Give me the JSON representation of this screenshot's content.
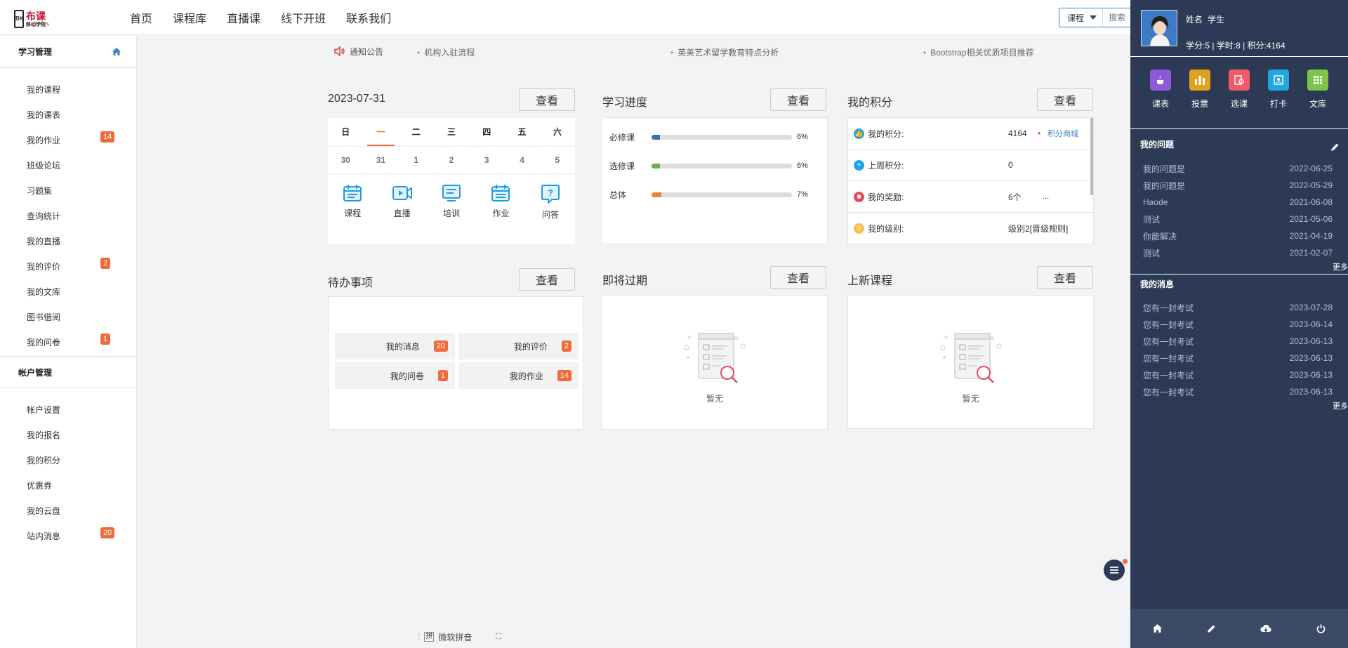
{
  "header": {
    "logo_text": "布课",
    "logo_sub": "移动学院",
    "nav": [
      "首页",
      "课程库",
      "直播课",
      "线下开班",
      "联系我们"
    ],
    "search_select": "课程",
    "search_placeholder": "搜索"
  },
  "sidebar": {
    "section1_title": "学习管理",
    "section1_items": [
      {
        "label": "我的课程",
        "badge": ""
      },
      {
        "label": "我的课表",
        "badge": ""
      },
      {
        "label": "我的作业",
        "badge": "14"
      },
      {
        "label": "班级论坛",
        "badge": ""
      },
      {
        "label": "习题集",
        "badge": ""
      },
      {
        "label": "查询统计",
        "badge": ""
      },
      {
        "label": "我的直播",
        "badge": ""
      },
      {
        "label": "我的评价",
        "badge": "2"
      },
      {
        "label": "我的文库",
        "badge": ""
      },
      {
        "label": "图书借阅",
        "badge": ""
      },
      {
        "label": "我的问卷",
        "badge": "1"
      }
    ],
    "section2_title": "帐户管理",
    "section2_items": [
      {
        "label": "帐户设置",
        "badge": ""
      },
      {
        "label": "我的报名",
        "badge": ""
      },
      {
        "label": "我的积分",
        "badge": ""
      },
      {
        "label": "优惠券",
        "badge": ""
      },
      {
        "label": "我的云盘",
        "badge": ""
      },
      {
        "label": "站内消息",
        "badge": "20"
      }
    ]
  },
  "notice": {
    "label": "通知公告",
    "items": [
      "机构入驻流程",
      "英美艺术留学教育特点分析",
      "Bootstrap相关优质项目推荐"
    ]
  },
  "view_label": "查看",
  "calendar": {
    "date": "2023-07-31",
    "weekdays": [
      "日",
      "一",
      "二",
      "三",
      "四",
      "五",
      "六"
    ],
    "dates": [
      "30",
      "31",
      "1",
      "2",
      "3",
      "4",
      "5"
    ],
    "active_index": 1,
    "icons": [
      {
        "name": "course-icon",
        "label": "课程"
      },
      {
        "name": "live-icon",
        "label": "直播"
      },
      {
        "name": "training-icon",
        "label": "培训"
      },
      {
        "name": "homework-icon",
        "label": "作业"
      },
      {
        "name": "qa-icon",
        "label": "问答"
      }
    ]
  },
  "progress": {
    "title": "学习进度",
    "rows": [
      {
        "label": "必修课",
        "percent": 6,
        "pct_text": "6%",
        "color": "#3b6cb7"
      },
      {
        "label": "选修课",
        "percent": 6,
        "pct_text": "6%",
        "color": "#6ab04c"
      },
      {
        "label": "总体",
        "percent": 7,
        "pct_text": "7%",
        "color": "#e8843a"
      }
    ]
  },
  "points": {
    "title": "我的积分",
    "rows": [
      {
        "icon": "thumbs-up-icon",
        "label": "我的积分:",
        "value": "4164",
        "link": "积分商城"
      },
      {
        "icon": "plus-circle-icon",
        "label": "上周积分:",
        "value": "0",
        "link": ""
      },
      {
        "icon": "gift-icon",
        "label": "我的奖励:",
        "value": "6个",
        "link": "..."
      },
      {
        "icon": "smile-icon",
        "label": "我的级别:",
        "value": "级别2[晋级规则]",
        "link": ""
      }
    ]
  },
  "todo": {
    "title": "待办事项",
    "items": [
      {
        "label": "我的消息",
        "badge": "20"
      },
      {
        "label": "我的评价",
        "badge": "2"
      },
      {
        "label": "我的问卷",
        "badge": "1"
      },
      {
        "label": "我的作业",
        "badge": "14"
      }
    ]
  },
  "expiring": {
    "title": "即将过期",
    "empty_text": "暂无"
  },
  "new_courses": {
    "title": "上新课程",
    "empty_text": "暂无"
  },
  "user": {
    "name": "姓名",
    "role": "学生",
    "stats": "学分:5 | 学时:8 | 积分:4164"
  },
  "quick": [
    {
      "label": "课表",
      "color": "#8c5ad8",
      "icon": "coffee-icon"
    },
    {
      "label": "投票",
      "color": "#e0a020",
      "icon": "bar-chart-icon"
    },
    {
      "label": "选课",
      "color": "#f05a6a",
      "icon": "select-course-icon"
    },
    {
      "label": "打卡",
      "color": "#22a8e0",
      "icon": "checkin-icon"
    },
    {
      "label": "文库",
      "color": "#7ec34a",
      "icon": "grid-icon"
    }
  ],
  "questions": {
    "title": "我的问题",
    "more": "更多",
    "rows": [
      {
        "text": "我的问题是",
        "date": "2022-06-25"
      },
      {
        "text": "我的问题是",
        "date": "2022-05-29"
      },
      {
        "text": "Haode",
        "date": "2021-06-08"
      },
      {
        "text": "测试",
        "date": "2021-05-06"
      },
      {
        "text": "你能解决",
        "date": "2021-04-19"
      },
      {
        "text": "测试",
        "date": "2021-02-07"
      }
    ]
  },
  "messages": {
    "title": "我的消息",
    "more": "更多",
    "rows": [
      {
        "text": "您有一封考试",
        "date": "2023-07-28"
      },
      {
        "text": "您有一封考试",
        "date": "2023-06-14"
      },
      {
        "text": "您有一封考试",
        "date": "2023-06-13"
      },
      {
        "text": "您有一封考试",
        "date": "2023-06-13"
      },
      {
        "text": "您有一封考试",
        "date": "2023-06-13"
      },
      {
        "text": "您有一封考试",
        "date": "2023-06-13"
      }
    ]
  },
  "ime_label": "微软拼音",
  "ime_box": "拼"
}
